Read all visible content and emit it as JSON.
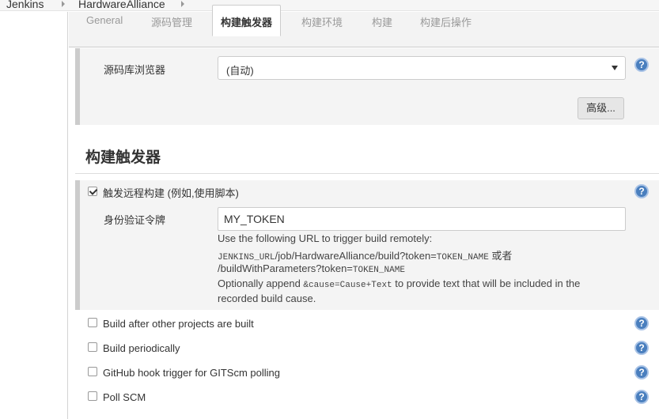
{
  "breadcrumb": {
    "items": [
      "Jenkins",
      "HardwareAlliance"
    ]
  },
  "tabs": [
    {
      "label": "General"
    },
    {
      "label": "源码管理"
    },
    {
      "label": "构建触发器"
    },
    {
      "label": "构建环境"
    },
    {
      "label": "构建"
    },
    {
      "label": "构建后操作"
    }
  ],
  "source_browser": {
    "label": "源码库浏览器",
    "selected": "(自动)",
    "advanced_button": "高级..."
  },
  "section": {
    "title": "构建触发器"
  },
  "remote_trigger": {
    "label": "触发远程构建 (例如,使用脚本)",
    "checked": true,
    "token_label": "身份验证令牌",
    "token_value": "MY_TOKEN",
    "desc_line1": "Use the following URL to trigger build remotely:",
    "desc_line2_mono_a": "JENKINS_URL",
    "desc_line2_a": "/job/HardwareAlliance/build?token=",
    "desc_line2_mono_b": "TOKEN_NAME",
    "desc_line2_b": " 或者",
    "desc_line3_a": "/buildWithParameters?token=",
    "desc_line3_mono": "TOKEN_NAME",
    "desc_line4_a": "Optionally append ",
    "desc_line4_mono": "&cause=Cause+Text",
    "desc_line4_b": " to provide text that will be included in the",
    "desc_line5": "recorded build cause."
  },
  "triggers": [
    {
      "label": "Build after other projects are built",
      "checked": false
    },
    {
      "label": "Build periodically",
      "checked": false
    },
    {
      "label": "GitHub hook trigger for GITScm polling",
      "checked": false
    },
    {
      "label": "Poll SCM",
      "checked": false
    }
  ],
  "help_icon_glyph": "?",
  "colors": {
    "help_blue": "#4a7fbe",
    "block_bg": "#f4f4f4",
    "block_border": "#cccccc"
  }
}
